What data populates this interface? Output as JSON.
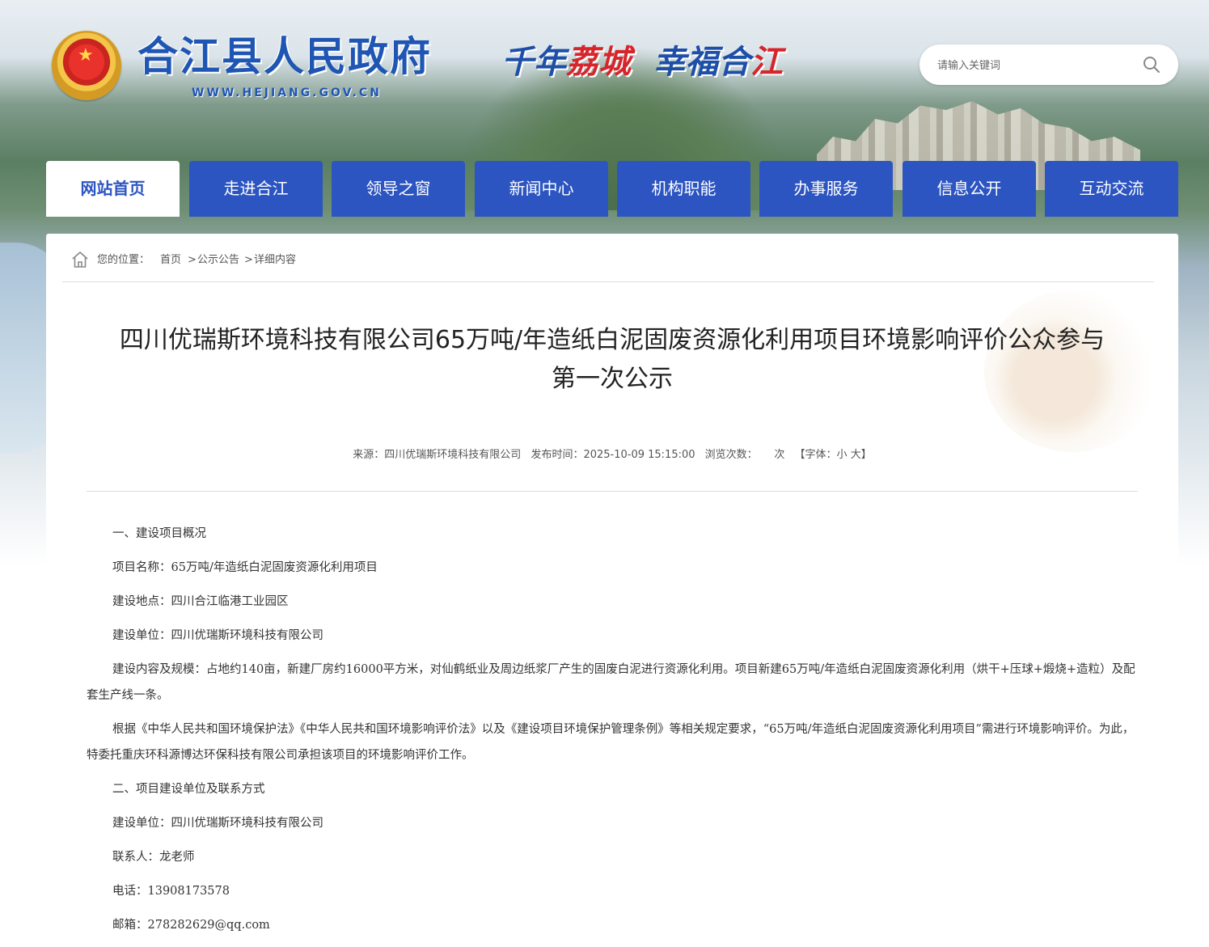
{
  "header": {
    "site_title": "合江县人民政府",
    "site_url": "WWW.HEJIANG.GOV.CN",
    "slogan_part1": "千年",
    "slogan_part2": "荔城",
    "slogan_part3": "幸福合",
    "slogan_part4": "江",
    "search_placeholder": "请输入关键词"
  },
  "nav": [
    {
      "label": "网站首页",
      "active": true
    },
    {
      "label": "走进合江"
    },
    {
      "label": "领导之窗"
    },
    {
      "label": "新闻中心"
    },
    {
      "label": "机构职能"
    },
    {
      "label": "办事服务"
    },
    {
      "label": "信息公开"
    },
    {
      "label": "互动交流"
    }
  ],
  "breadcrumb": {
    "prefix": "您的位置：",
    "home": "首页",
    "sep": ">",
    "section": "公示公告",
    "current": "详细内容"
  },
  "article": {
    "title_line1": "四川优瑞斯环境科技有限公司65万吨/年造纸白泥固废资源化利用项目环境影响评价公众参与",
    "title_line2": "第一次公示",
    "meta": {
      "source_label": "来源：",
      "source": "四川优瑞斯环境科技有限公司",
      "date_label": "发布时间：",
      "date": "2025-10-09 15:15:00",
      "views_label": "浏览次数：",
      "views_unit": "次",
      "font_label": "【字体：",
      "font_small": "小",
      "font_large": "大",
      "font_close": "】"
    },
    "paragraphs": [
      "一、建设项目概况",
      "项目名称：65万吨/年造纸白泥固废资源化利用项目",
      "建设地点：四川合江临港工业园区",
      "建设单位：四川优瑞斯环境科技有限公司",
      "建设内容及规模：占地约140亩，新建厂房约16000平方米，对仙鹤纸业及周边纸浆厂产生的固废白泥进行资源化利用。项目新建65万吨/年造纸白泥固废资源化利用（烘干+压球+煅烧+造粒）及配套生产线一条。",
      "根据《中华人民共和国环境保护法》《中华人民共和国环境影响评价法》以及《建设项目环境保护管理条例》等相关规定要求，“65万吨/年造纸白泥固废资源化利用项目”需进行环境影响评价。为此，特委托重庆环科源博达环保科技有限公司承担该项目的环境影响评价工作。",
      "二、项目建设单位及联系方式",
      "建设单位：四川优瑞斯环境科技有限公司",
      "联系人：龙老师",
      "电话：13908173578",
      "邮箱：278282629@qq.com"
    ]
  }
}
